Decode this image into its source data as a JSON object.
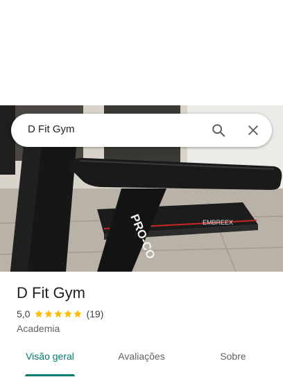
{
  "search": {
    "query": "D Fit Gym"
  },
  "photo": {
    "brand_text": "PRO-CO",
    "logo_text": "EMBREEX"
  },
  "place": {
    "name": "D Fit Gym",
    "rating": "5,0",
    "stars": 5,
    "reviews_count": "(19)",
    "category": "Academia"
  },
  "tabs": [
    {
      "label": "Visão geral",
      "active": true
    },
    {
      "label": "Avaliações",
      "active": false
    },
    {
      "label": "Sobre",
      "active": false
    }
  ],
  "colors": {
    "accent": "#01796f",
    "star": "#fbbc04"
  }
}
